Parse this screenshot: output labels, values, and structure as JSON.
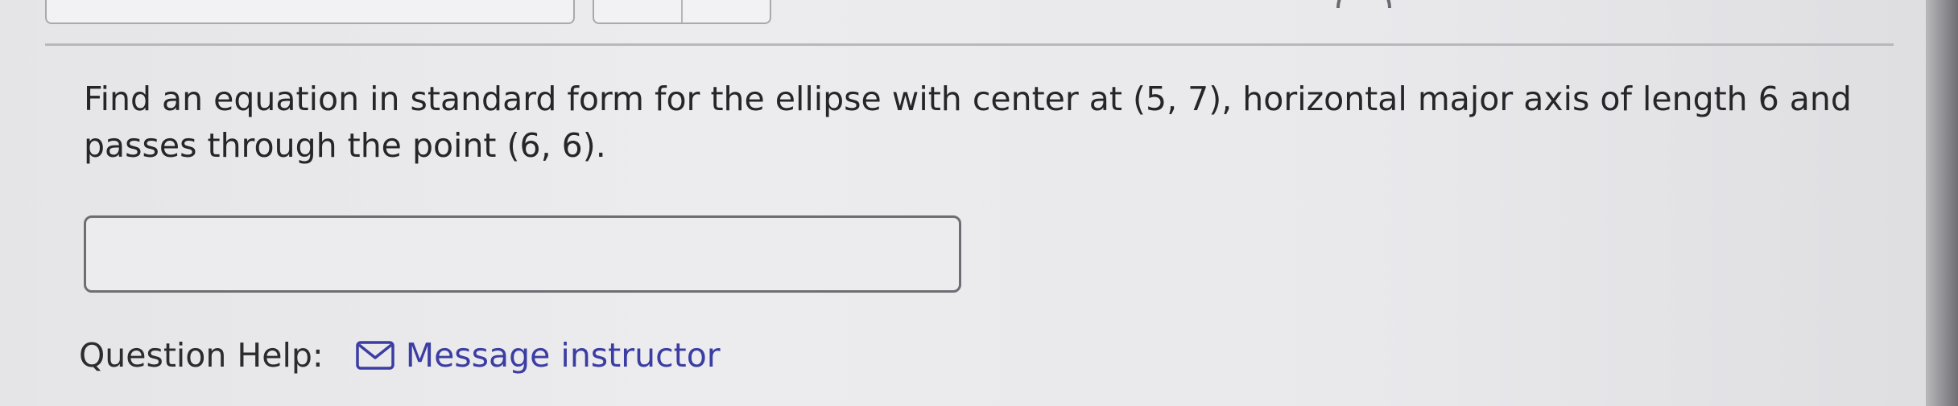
{
  "question": {
    "text": "Find an equation in standard form for the ellipse with center at (5, 7), horizontal major axis of length 6 and passes through the point (6, 6)."
  },
  "answer": {
    "value": "",
    "placeholder": ""
  },
  "help": {
    "label": "Question Help:",
    "message_link": "Message instructor",
    "icon": "envelope-icon"
  },
  "colors": {
    "link": "#3b3da3",
    "text": "#26262a",
    "border": "#6d6d73"
  }
}
